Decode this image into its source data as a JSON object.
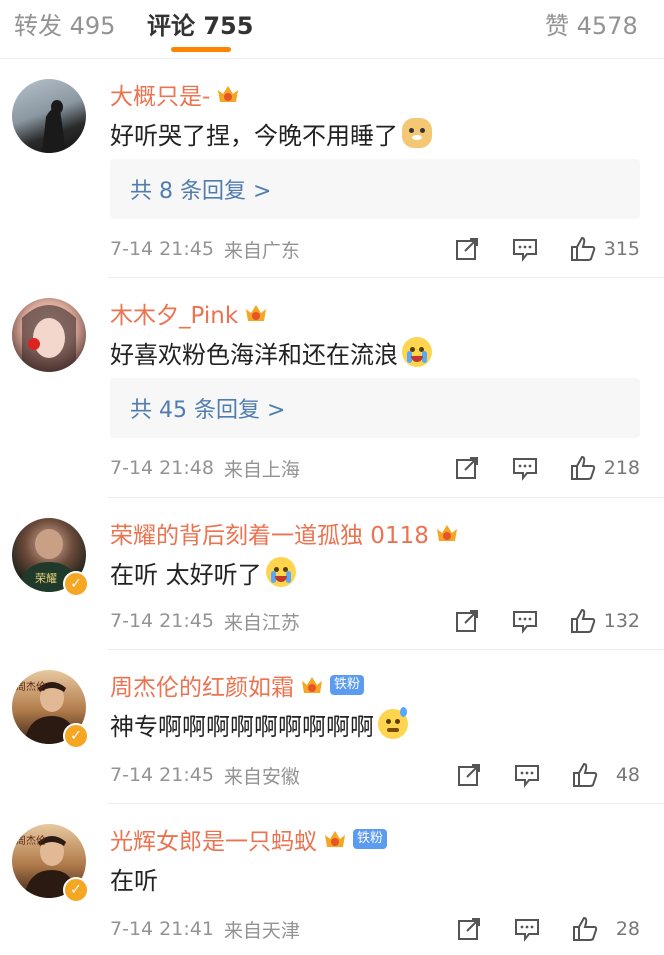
{
  "tabs": [
    {
      "label": "转发",
      "count": "495"
    },
    {
      "label": "评论",
      "count": "755"
    },
    {
      "label": "赞",
      "count": "4578"
    }
  ],
  "comments": [
    {
      "username": "大概只是-",
      "level": "4",
      "text": "好听哭了捏，今晚不用睡了",
      "emoji": "doge-emoji",
      "reply": "共 8 条回复 >",
      "time": "7-14 21:45",
      "source": "来自广东",
      "likes": "315",
      "avatar_icon": "silhouette-avatar"
    },
    {
      "username": "木木夕_Pink",
      "level": "5",
      "text": "好喜欢粉色海洋和还在流浪",
      "emoji": "crying-emoji",
      "reply": "共 45 条回复 >",
      "time": "7-14 21:48",
      "source": "来自上海",
      "likes": "218",
      "avatar_icon": "girl-avatar"
    },
    {
      "username": "荣耀的背后刻着一道孤独 0118",
      "level": "6",
      "text": "在听 太好听了",
      "emoji": "crying-emoji",
      "time": "7-14 21:45",
      "source": "来自江苏",
      "likes": "132",
      "avatar_icon": "athlete-avatar",
      "avatar_text": "荣耀"
    },
    {
      "username": "周杰伦的红颜如霜",
      "level": "6",
      "badge": "铁粉",
      "text": "神专啊啊啊啊啊啊啊啊啊",
      "emoji": "sweat-emoji",
      "time": "7-14 21:45",
      "source": "来自安徽",
      "likes": "48",
      "avatar_icon": "jay-chou-avatar",
      "avatar_text": "周杰伦"
    },
    {
      "username": "光辉女郎是一只蚂蚁",
      "level": "6",
      "badge": "铁粉",
      "text": "在听",
      "time": "7-14 21:41",
      "source": "来自天津",
      "likes": "28",
      "avatar_icon": "jay-chou-avatar",
      "avatar_text": "周杰伦"
    }
  ],
  "colors": {
    "accent": "#ff8200",
    "username": "#eb7350",
    "reply_link": "#507daf",
    "meta": "#939393"
  }
}
